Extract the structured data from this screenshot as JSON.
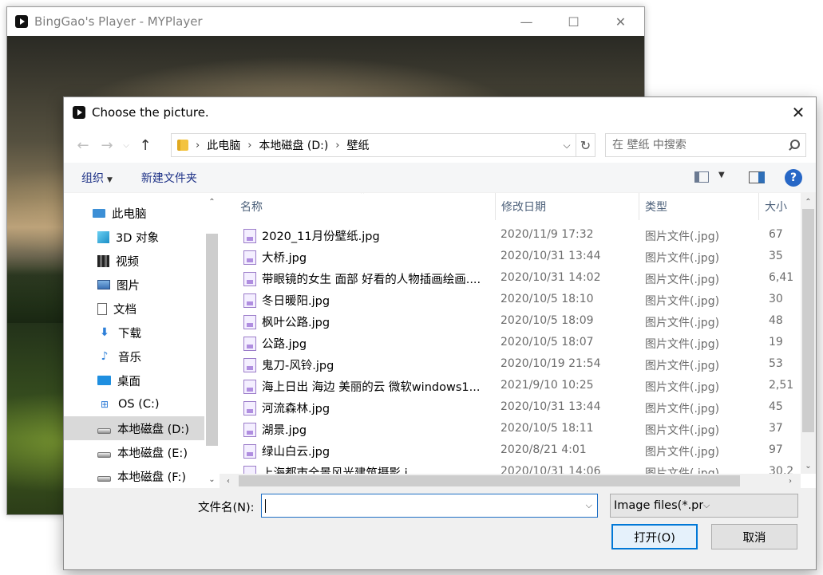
{
  "player": {
    "title": "BingGao's Player - MYPlayer",
    "controls": {
      "minimize": "—",
      "maximize": "☐",
      "close": "✕"
    }
  },
  "dialog": {
    "title": "Choose the picture.",
    "close": "✕",
    "nav": {
      "back": "←",
      "forward": "→",
      "recent": "⌵",
      "up": "↑"
    },
    "breadcrumb": [
      "此电脑",
      "本地磁盘 (D:)",
      "壁纸"
    ],
    "breadcrumb_sep": "›",
    "address_dropdown": "⌵",
    "refresh": "↻",
    "search_placeholder": "在 壁纸 中搜索",
    "commands": {
      "organize": "组织",
      "new_folder": "新建文件夹",
      "help": "?"
    },
    "sidebar": [
      {
        "label": "此电脑",
        "icon": "computer-icon",
        "level": "top"
      },
      {
        "label": "3D 对象",
        "icon": "3d-objects-icon",
        "level": "sub"
      },
      {
        "label": "视频",
        "icon": "video-icon",
        "level": "sub"
      },
      {
        "label": "图片",
        "icon": "pictures-icon",
        "level": "sub"
      },
      {
        "label": "文档",
        "icon": "documents-icon",
        "level": "sub"
      },
      {
        "label": "下载",
        "icon": "downloads-icon",
        "level": "sub"
      },
      {
        "label": "音乐",
        "icon": "music-icon",
        "level": "sub"
      },
      {
        "label": "桌面",
        "icon": "desktop-icon",
        "level": "sub"
      },
      {
        "label": "OS (C:)",
        "icon": "windows-drive-icon",
        "level": "sub"
      },
      {
        "label": "本地磁盘 (D:)",
        "icon": "drive-icon",
        "level": "sub",
        "selected": true
      },
      {
        "label": "本地磁盘 (E:)",
        "icon": "drive-icon",
        "level": "sub"
      },
      {
        "label": "本地磁盘 (F:)",
        "icon": "drive-icon",
        "level": "sub"
      }
    ],
    "columns": {
      "name": "名称",
      "date": "修改日期",
      "type": "类型",
      "size": "大小"
    },
    "files": [
      {
        "name": "2020_11月份壁纸.jpg",
        "date": "2020/11/9 17:32",
        "type": "图片文件(.jpg)",
        "size": "67"
      },
      {
        "name": "大桥.jpg",
        "date": "2020/10/31 13:44",
        "type": "图片文件(.jpg)",
        "size": "35"
      },
      {
        "name": "带眼镜的女生 面部 好看的人物插画绘画....",
        "date": "2020/10/31 14:02",
        "type": "图片文件(.jpg)",
        "size": "6,41"
      },
      {
        "name": "冬日暖阳.jpg",
        "date": "2020/10/5 18:10",
        "type": "图片文件(.jpg)",
        "size": "30"
      },
      {
        "name": "枫叶公路.jpg",
        "date": "2020/10/5 18:09",
        "type": "图片文件(.jpg)",
        "size": "48"
      },
      {
        "name": "公路.jpg",
        "date": "2020/10/5 18:07",
        "type": "图片文件(.jpg)",
        "size": "19"
      },
      {
        "name": "鬼刀-风铃.jpg",
        "date": "2020/10/19 21:54",
        "type": "图片文件(.jpg)",
        "size": "53"
      },
      {
        "name": "海上日出 海边 美丽的云 微软windows1...",
        "date": "2021/9/10 10:25",
        "type": "图片文件(.jpg)",
        "size": "2,51"
      },
      {
        "name": "河流森林.jpg",
        "date": "2020/10/31 13:44",
        "type": "图片文件(.jpg)",
        "size": "45"
      },
      {
        "name": "湖景.jpg",
        "date": "2020/10/5 18:11",
        "type": "图片文件(.jpg)",
        "size": "37"
      },
      {
        "name": "绿山白云.jpg",
        "date": "2020/8/21 4:01",
        "type": "图片文件(.jpg)",
        "size": "97"
      },
      {
        "name": "上海都市全景风光建筑摄影.j...",
        "date": "2020/10/31 14:06",
        "type": "图片文件(.jpg)",
        "size": "30,2"
      }
    ],
    "filename_label": "文件名(N):",
    "filename_value": "",
    "filetype": "Image files(*.png *.jpg *.bmp)",
    "open_button": "打开(O)",
    "cancel_button": "取消"
  }
}
